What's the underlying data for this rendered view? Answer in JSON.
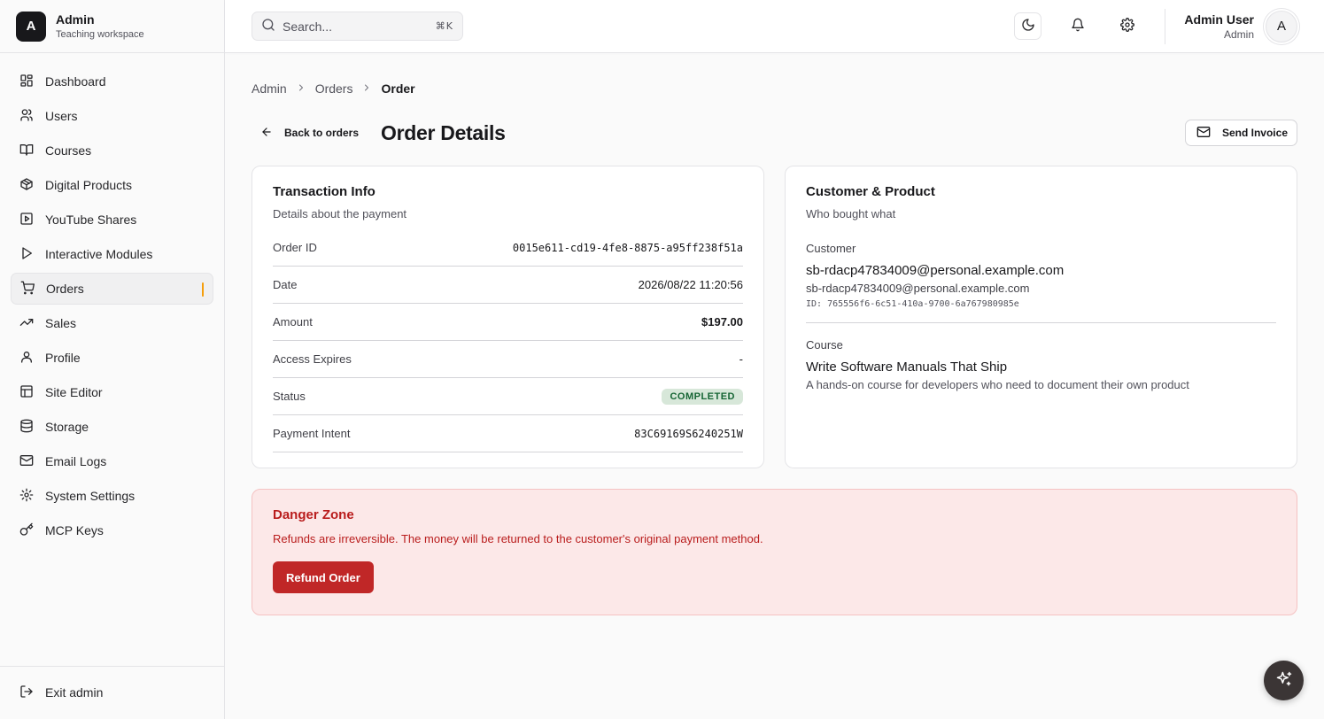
{
  "brand": {
    "logo_letter": "A",
    "name": "Admin",
    "subtitle": "Teaching workspace"
  },
  "sidebar": {
    "items": [
      {
        "label": "Dashboard",
        "icon": "home-icon"
      },
      {
        "label": "Users",
        "icon": "users-icon"
      },
      {
        "label": "Courses",
        "icon": "book-icon"
      },
      {
        "label": "Digital Products",
        "icon": "package-icon"
      },
      {
        "label": "YouTube Shares",
        "icon": "square-play-icon"
      },
      {
        "label": "Interactive Modules",
        "icon": "play-icon"
      },
      {
        "label": "Orders",
        "icon": "cart-icon",
        "active": true
      },
      {
        "label": "Sales",
        "icon": "trending-up-icon"
      },
      {
        "label": "Profile",
        "icon": "user-icon"
      },
      {
        "label": "Site Editor",
        "icon": "layout-icon"
      },
      {
        "label": "Storage",
        "icon": "database-icon"
      },
      {
        "label": "Email Logs",
        "icon": "mail-icon"
      },
      {
        "label": "System Settings",
        "icon": "gear-icon"
      },
      {
        "label": "MCP Keys",
        "icon": "key-icon"
      }
    ],
    "footer_label": "Exit admin"
  },
  "topbar": {
    "search_placeholder": "Search...",
    "search_shortcut": "⌘K",
    "user_name": "Admin User",
    "user_role": "Admin",
    "avatar_letter": "A"
  },
  "breadcrumb": {
    "items": [
      "Admin",
      "Orders"
    ],
    "current": "Order"
  },
  "header": {
    "back_label": "Back to orders",
    "title": "Order Details",
    "send_invoice_label": "Send Invoice"
  },
  "transaction": {
    "title": "Transaction Info",
    "subtitle": "Details about the payment",
    "rows": [
      {
        "label": "Order ID",
        "value": "0015e611-cd19-4fe8-8875-a95ff238f51a"
      },
      {
        "label": "Date",
        "value": "2026/08/22 11:20:56"
      },
      {
        "label": "Amount",
        "value": "$197.00"
      },
      {
        "label": "Access Expires",
        "value": "-"
      },
      {
        "label": "Status",
        "value": "COMPLETED"
      },
      {
        "label": "Payment Intent",
        "value": "83C69169S6240251W"
      }
    ]
  },
  "customer_product": {
    "title": "Customer & Product",
    "subtitle": "Who bought what",
    "customer_label": "Customer",
    "customer_name": "sb-rdacp47834009@personal.example.com",
    "customer_email": "sb-rdacp47834009@personal.example.com",
    "customer_id": "ID: 765556f6-6c51-410a-9700-6a767980985e",
    "course_label": "Course",
    "course_name": "Write Software Manuals That Ship",
    "course_description": "A hands-on course for developers who need to document their own product"
  },
  "danger_zone": {
    "title": "Danger Zone",
    "text": "Refunds are irreversible. The money will be returned to the customer's original payment method.",
    "button_label": "Refund Order"
  },
  "colors": {
    "accent": "#f59e0b",
    "danger": "#c02727",
    "success_bg": "#d7e7d9",
    "success_text": "#166534"
  }
}
